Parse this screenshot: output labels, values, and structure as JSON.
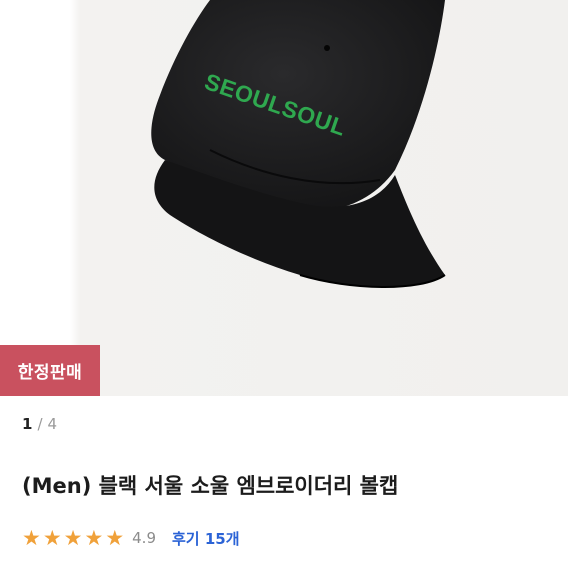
{
  "product": {
    "image_text": "SEOULSOUL",
    "badge": "한정판매",
    "pager": {
      "current": "1",
      "separator": "/",
      "total": "4"
    },
    "title": "(Men) 블랙 서울 소울 엠브로이더리 볼캡",
    "rating": {
      "stars_filled": 5,
      "stars_total": 5,
      "score": "4.9",
      "review_label": "후기 15개"
    }
  },
  "colors": {
    "badge": "#c9515f",
    "star": "#f0a13a",
    "review_link": "#2b63d6",
    "cap": "#1c1c1e",
    "embroidery": "#2fa84f"
  },
  "icons": {
    "star": "star-icon"
  }
}
